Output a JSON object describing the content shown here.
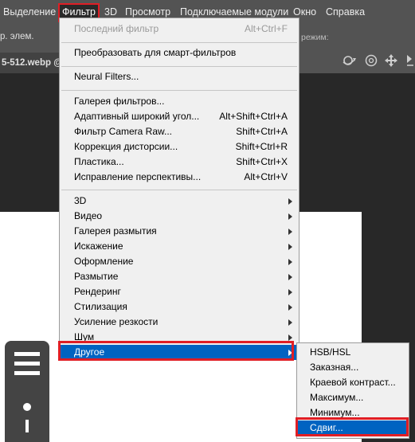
{
  "menubar": {
    "items": [
      "Выделение",
      "Фильтр",
      "3D",
      "Просмотр",
      "Подключаемые модули",
      "Окно",
      "Справка"
    ],
    "active_index": 1
  },
  "options_bar": {
    "left_text": "р. элем.",
    "mode_label": "режим:"
  },
  "document_tab": {
    "title": "5-512.webp @"
  },
  "filter_menu": {
    "items": [
      {
        "label": "Последний фильтр",
        "shortcut": "Alt+Ctrl+F",
        "disabled": true
      },
      {
        "label": "Преобразовать для смарт-фильтров",
        "shortcut": ""
      },
      {
        "label": "Neural Filters...",
        "shortcut": ""
      },
      {
        "label": "Галерея фильтров...",
        "shortcut": ""
      },
      {
        "label": "Адаптивный широкий угол...",
        "shortcut": "Alt+Shift+Ctrl+A"
      },
      {
        "label": "Фильтр Camera Raw...",
        "shortcut": "Shift+Ctrl+A"
      },
      {
        "label": "Коррекция дисторсии...",
        "shortcut": "Shift+Ctrl+R"
      },
      {
        "label": "Пластика...",
        "shortcut": "Shift+Ctrl+X"
      },
      {
        "label": "Исправление перспективы...",
        "shortcut": "Alt+Ctrl+V"
      },
      {
        "label": "3D",
        "submenu": true
      },
      {
        "label": "Видео",
        "submenu": true
      },
      {
        "label": "Галерея размытия",
        "submenu": true
      },
      {
        "label": "Искажение",
        "submenu": true
      },
      {
        "label": "Оформление",
        "submenu": true
      },
      {
        "label": "Размытие",
        "submenu": true
      },
      {
        "label": "Рендеринг",
        "submenu": true
      },
      {
        "label": "Стилизация",
        "submenu": true
      },
      {
        "label": "Усиление резкости",
        "submenu": true
      },
      {
        "label": "Шум",
        "submenu": true
      },
      {
        "label": "Другое",
        "submenu": true,
        "selected": true
      }
    ]
  },
  "other_submenu": {
    "items": [
      {
        "label": "HSB/HSL"
      },
      {
        "label": "Заказная..."
      },
      {
        "label": "Краевой контраст..."
      },
      {
        "label": "Максимум..."
      },
      {
        "label": "Минимум..."
      },
      {
        "label": "Сдвиг...",
        "selected": true
      }
    ]
  },
  "colors": {
    "highlight": "#e01e25",
    "selection": "#0063c1",
    "menu_bg": "#f0f0f0",
    "app_bg": "#535353"
  }
}
